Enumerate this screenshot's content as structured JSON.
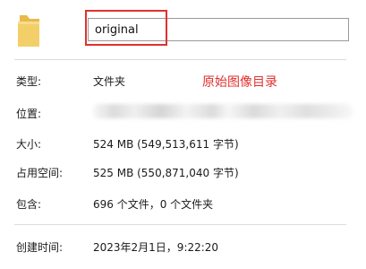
{
  "header": {
    "folder_name_value": "original",
    "icon": "folder-icon"
  },
  "annotation": {
    "text": "原始图像目录",
    "color": "#e0312f"
  },
  "properties": {
    "type_label": "类型:",
    "type_value": "文件夹",
    "location_label": "位置:",
    "size_label": "大小:",
    "size_value": "524 MB (549,513,611 字节)",
    "size_on_disk_label": "占用空间:",
    "size_on_disk_value": "525 MB (550,871,040 字节)",
    "contains_label": "包含:",
    "contains_value": "696 个文件，0 个文件夹",
    "created_label": "创建时间:",
    "created_value": "2023年2月1日，9:22:20"
  },
  "colors": {
    "highlight": "#e0312f",
    "folder": "#f3cf6a"
  }
}
